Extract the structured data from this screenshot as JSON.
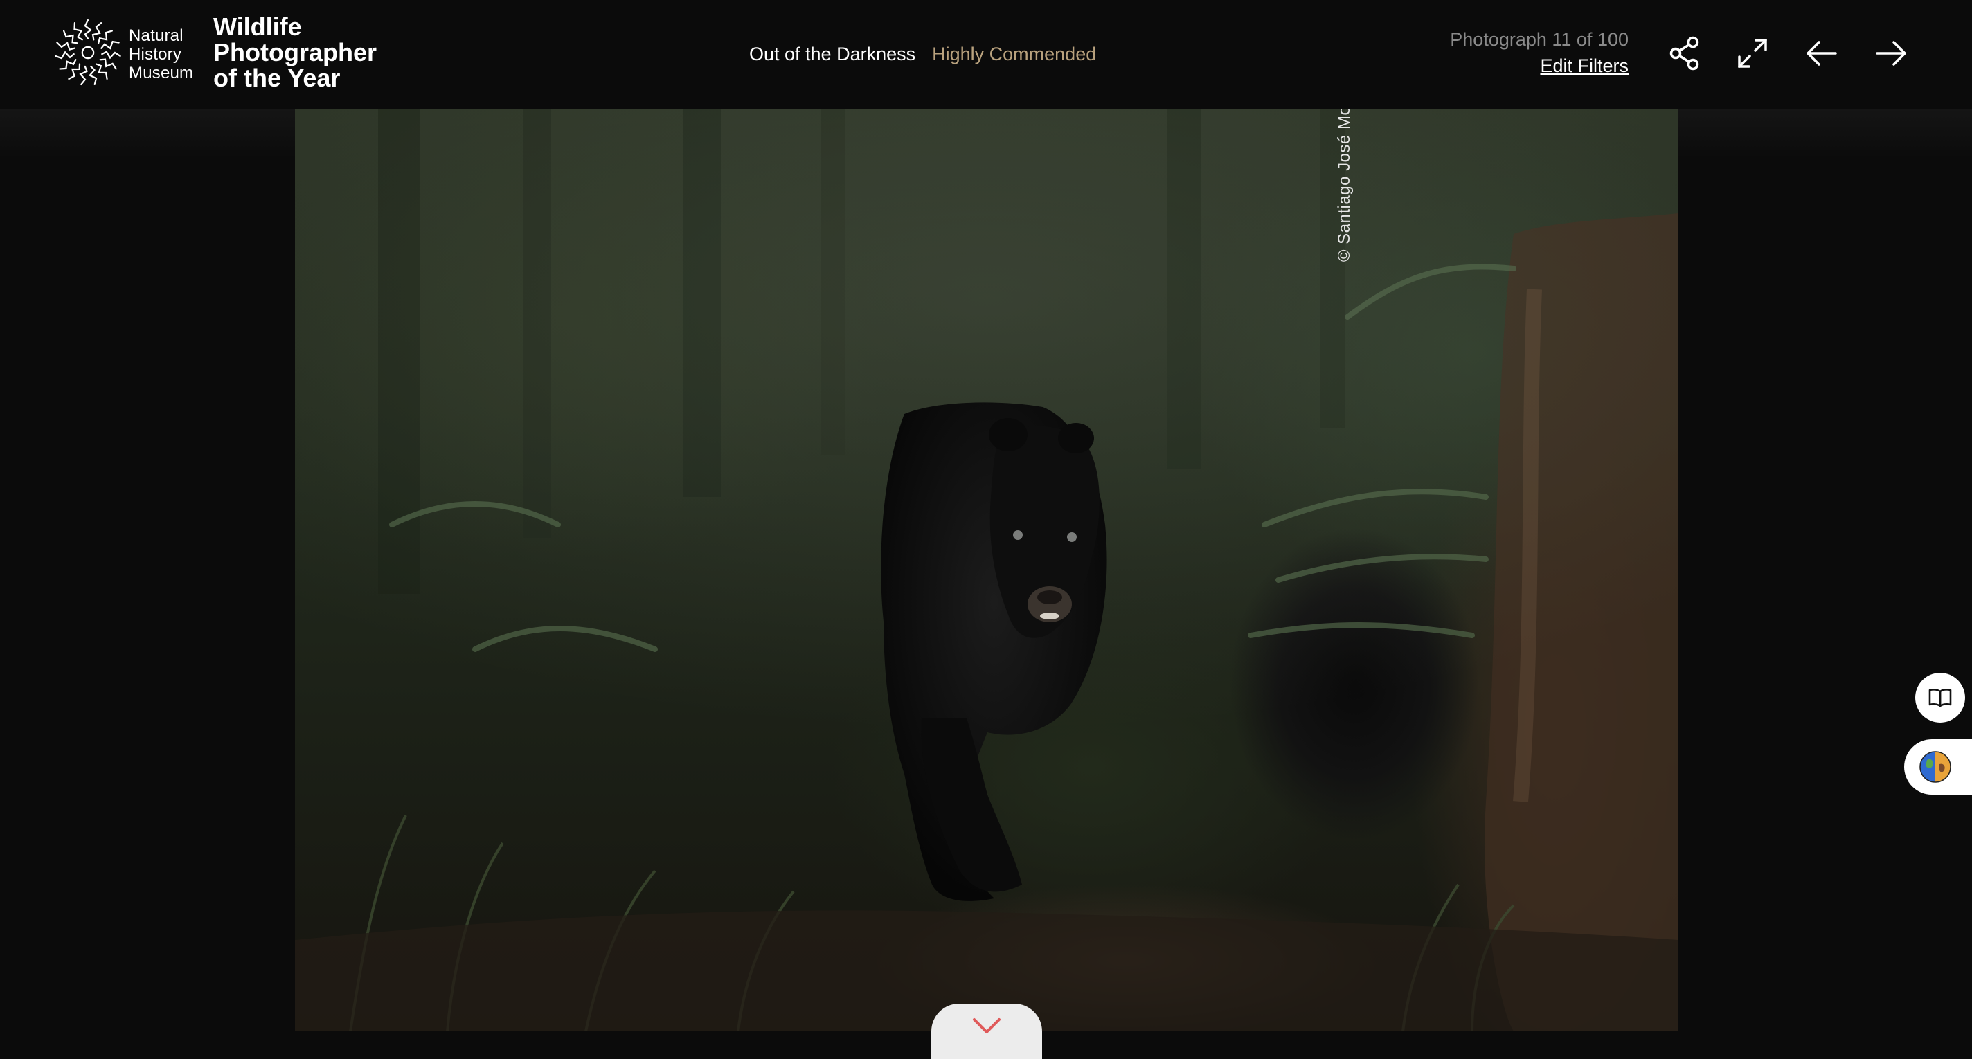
{
  "header": {
    "logo_nhm_lines": [
      "Natural",
      "History",
      "Museum"
    ],
    "logo_wpy_lines": [
      "Wildlife",
      "Photographer",
      "of the Year"
    ],
    "photo_title": "Out of the Darkness",
    "award": "Highly Commended",
    "counter": "Photograph 11 of 100",
    "edit_filters": "Edit Filters"
  },
  "icons": {
    "share": "share-icon",
    "fullscreen": "expand-icon",
    "prev": "arrow-left-icon",
    "next": "arrow-right-icon",
    "expand": "chevron-down-icon",
    "book": "book-icon",
    "globe": "globe-icon"
  },
  "photo": {
    "credit": "© Santiago José Monroy García"
  },
  "colors": {
    "background": "#0b0b0b",
    "award": "#b9a27e",
    "counter": "#8a8a8a"
  }
}
